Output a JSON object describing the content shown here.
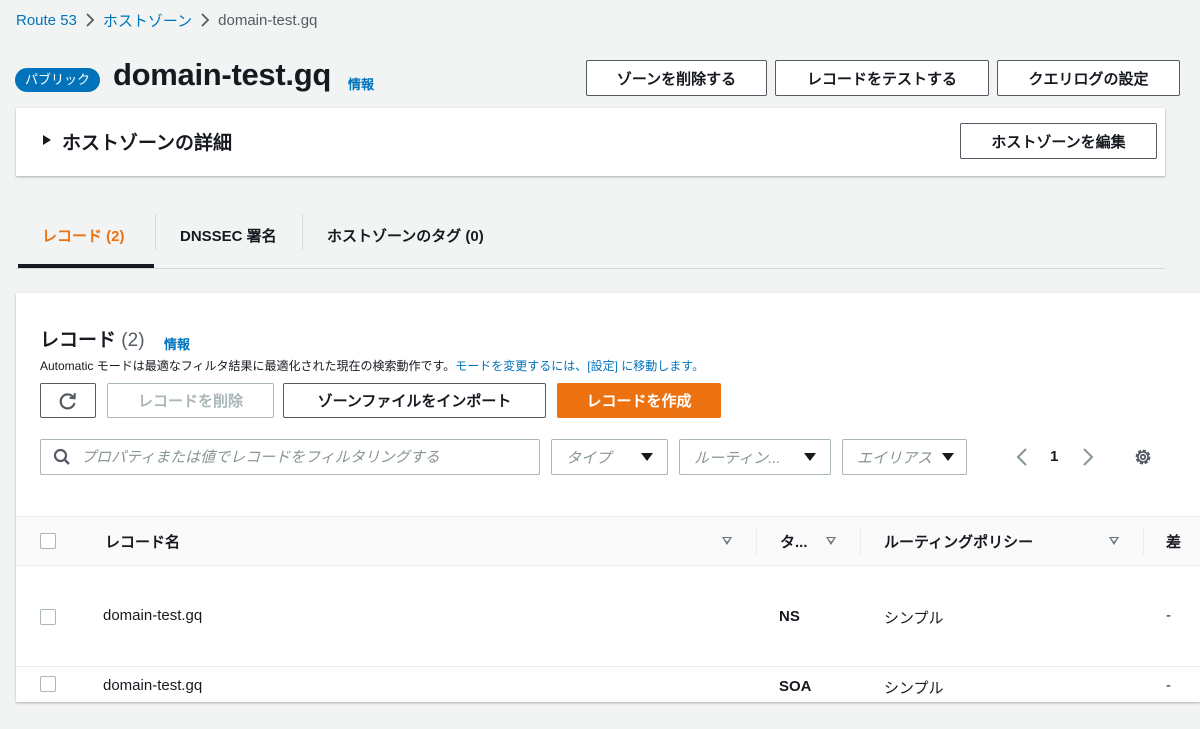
{
  "breadcrumb": {
    "items": [
      "Route 53",
      "ホストゾーン"
    ],
    "current": "domain-test.gq"
  },
  "header": {
    "badge": "パブリック",
    "title": "domain-test.gq",
    "info": "情報",
    "buttons": {
      "delete_zone": "ゾーンを削除する",
      "test_record": "レコードをテストする",
      "query_log": "クエリログの設定"
    }
  },
  "details": {
    "title": "ホストゾーンの詳細",
    "edit_button": "ホストゾーンを編集"
  },
  "tabs": [
    {
      "label": "レコード (2)",
      "active": true
    },
    {
      "label": "DNSSEC 署名",
      "active": false
    },
    {
      "label": "ホストゾーンのタグ (0)",
      "active": false
    }
  ],
  "records": {
    "heading": "レコード",
    "count": "(2)",
    "info": "情報",
    "description_prefix": "Automatic モードは最適なフィルタ結果に最適化された現在の検索動作です。",
    "description_link": "モードを変更するには、[設定] に移動します。",
    "buttons": {
      "delete": "レコードを削除",
      "import": "ゾーンファイルをインポート",
      "create": "レコードを作成"
    },
    "search_placeholder": "プロパティまたは値でレコードをフィルタリングする",
    "filters": {
      "type": "タイプ",
      "routing": "ルーティン...",
      "alias": "エイリアス"
    },
    "pager": {
      "current": "1"
    }
  },
  "table": {
    "columns": {
      "name": "レコード名",
      "type": "タ...",
      "routing": "ルーティングポリシー",
      "extra": "差"
    },
    "rows": [
      {
        "name": "domain-test.gq",
        "type": "NS",
        "routing": "シンプル",
        "extra": "-"
      },
      {
        "name": "domain-test.gq",
        "type": "SOA",
        "routing": "シンプル",
        "extra": "-"
      }
    ]
  },
  "colors": {
    "link": "#0073bb",
    "primary": "#ec7211",
    "text": "#16191f",
    "background": "#f2f3f3"
  }
}
